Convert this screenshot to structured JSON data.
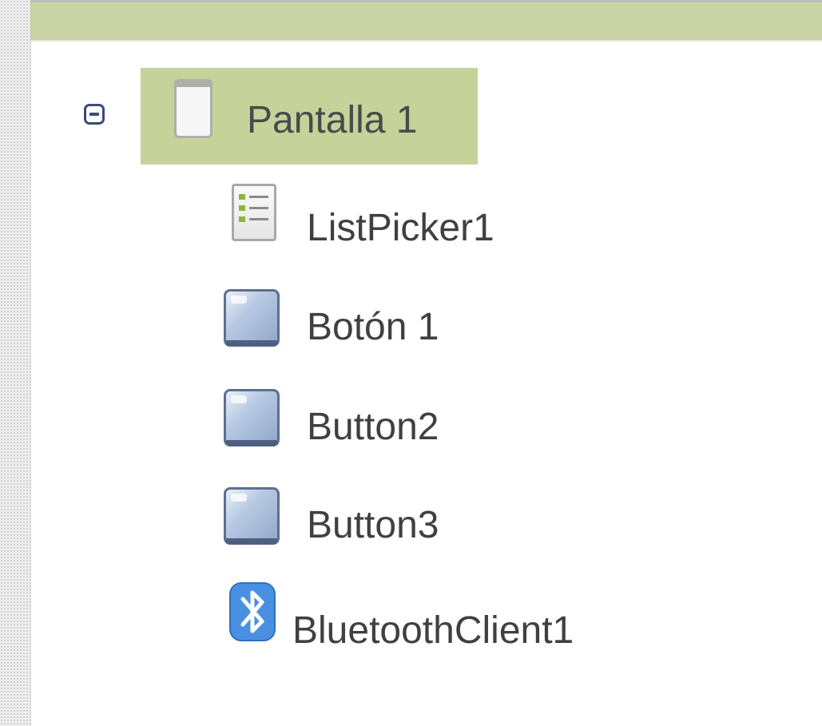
{
  "tree": {
    "root": {
      "label": "Pantalla 1",
      "icon": "screen-icon",
      "expanded": true,
      "selected": true
    },
    "children": [
      {
        "label": "ListPicker1",
        "icon": "listpicker-icon"
      },
      {
        "label": "Botón 1",
        "icon": "button-icon"
      },
      {
        "label": "Button2",
        "icon": "button-icon"
      },
      {
        "label": "Button3",
        "icon": "button-icon"
      },
      {
        "label": "BluetoothClient1",
        "icon": "bluetooth-icon"
      }
    ]
  },
  "colors": {
    "selection": "#c5d29a",
    "header_band": "#c9d3a3",
    "toggle": "#3b4a78",
    "bluetooth": "#4a90e2"
  }
}
